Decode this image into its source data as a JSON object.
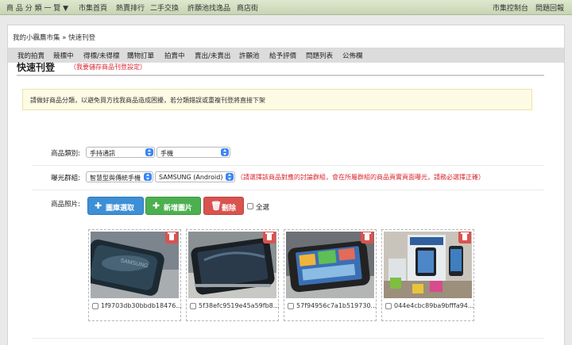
{
  "topbar": {
    "left": [
      "商 品 分 類 一 覽 ▼",
      "市集首頁",
      "熱賣排行",
      "二手交換",
      "許願池找逸品",
      "商店街"
    ],
    "right": [
      "市集控制台",
      "問題回報"
    ]
  },
  "breadcrumb": {
    "home": "我的小靏鷹市集",
    "separator": "»",
    "current": "快速刊登"
  },
  "nav": [
    "我的拍賣",
    "競標中",
    "得標/未得標",
    "購物訂單",
    "拍賣中",
    "賣出/未賣出",
    "許願池",
    "給予評價",
    "問題列表",
    "公佈欄"
  ],
  "section": {
    "title": "快速刊登",
    "note": "（我要儲存商品刊登設定）"
  },
  "notice": "請做好商品分類，以避免買方找我商品造成困擾，若分類錯誤或重複刊登將直接下架",
  "category": {
    "label": "商品類別:",
    "primary": "手持通訊",
    "secondary": "手機"
  },
  "exposure": {
    "label": "曝光群組:",
    "primary": "智慧型與傳統手機",
    "secondary": "SAMSUNG (Android)",
    "note": "（請選擇該商品對應的討論群組，會在所屬群組的商品頁實頁面曝光，請務必選擇正確）"
  },
  "photos": {
    "label": "商品照片:",
    "buttons": {
      "library": "圖庫選取",
      "add": "新增圖片",
      "delete": "刪除"
    },
    "select_all": "全選",
    "items": [
      {
        "file": "1f9703db30bbdb18476...",
        "icon": "phone-back-photo"
      },
      {
        "file": "5f38efc9519e45a59fb8...",
        "icon": "phone-side-photo"
      },
      {
        "file": "57f94956c7a1b519730...",
        "icon": "phone-front-photo"
      },
      {
        "file": "044e4cbc89ba9bfffa94...",
        "icon": "phone-box-photo"
      }
    ]
  },
  "colors": {
    "accent_blue": "#3d8fd6",
    "accent_green": "#4cb050",
    "danger_red": "#d9534f",
    "note_red": "#d8262e",
    "topbar": "#d2dfc2"
  }
}
